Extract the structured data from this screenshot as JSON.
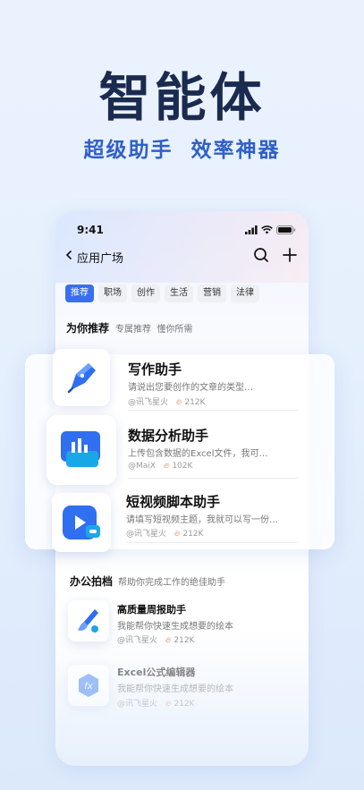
{
  "hero": {
    "title": "智能体",
    "subtitle": "超级助手  效率神器"
  },
  "status": {
    "time": "9:41"
  },
  "nav": {
    "back_icon": "chevron-left-icon",
    "title": "应用广场"
  },
  "tabs": [
    "推荐",
    "职场",
    "创作",
    "生活",
    "营销",
    "法律"
  ],
  "recommend": {
    "title": "为你推荐",
    "subtitle": "专属推荐  懂你所需"
  },
  "featured": [
    {
      "name": "写作助手",
      "desc": "请说出您要创作的文章的类型…",
      "author": "@讯飞星火",
      "hot": "212K",
      "icon": "pen-icon"
    },
    {
      "name": "数据分析助手",
      "desc": "上传包含数据的Excel文件，我可…",
      "author": "@MaiX",
      "hot": "102K",
      "icon": "chart-icon"
    },
    {
      "name": "短视频脚本助手",
      "desc": "请填写短视频主题，我就可以写一份…",
      "author": "@讯飞星火",
      "hot": "212K",
      "icon": "video-icon"
    }
  ],
  "office": {
    "title": "办公拍档",
    "subtitle": "帮助你完成工作的绝佳助手",
    "items": [
      {
        "name": "高质量周报助手",
        "desc": "我能帮你快速生成想要的绘本",
        "author": "@讯飞星火",
        "hot": "212K",
        "icon": "brush-icon"
      },
      {
        "name": "Excel公式编辑器",
        "desc": "我能帮你快速生成想要的绘本",
        "author": "@讯飞星火",
        "hot": "212K",
        "icon": "fx-icon"
      }
    ]
  },
  "colors": {
    "accent": "#3a6df0",
    "hero_title": "#1b2a4f",
    "hero_sub": "#2f5fc7",
    "hot": "#f07a4a"
  }
}
